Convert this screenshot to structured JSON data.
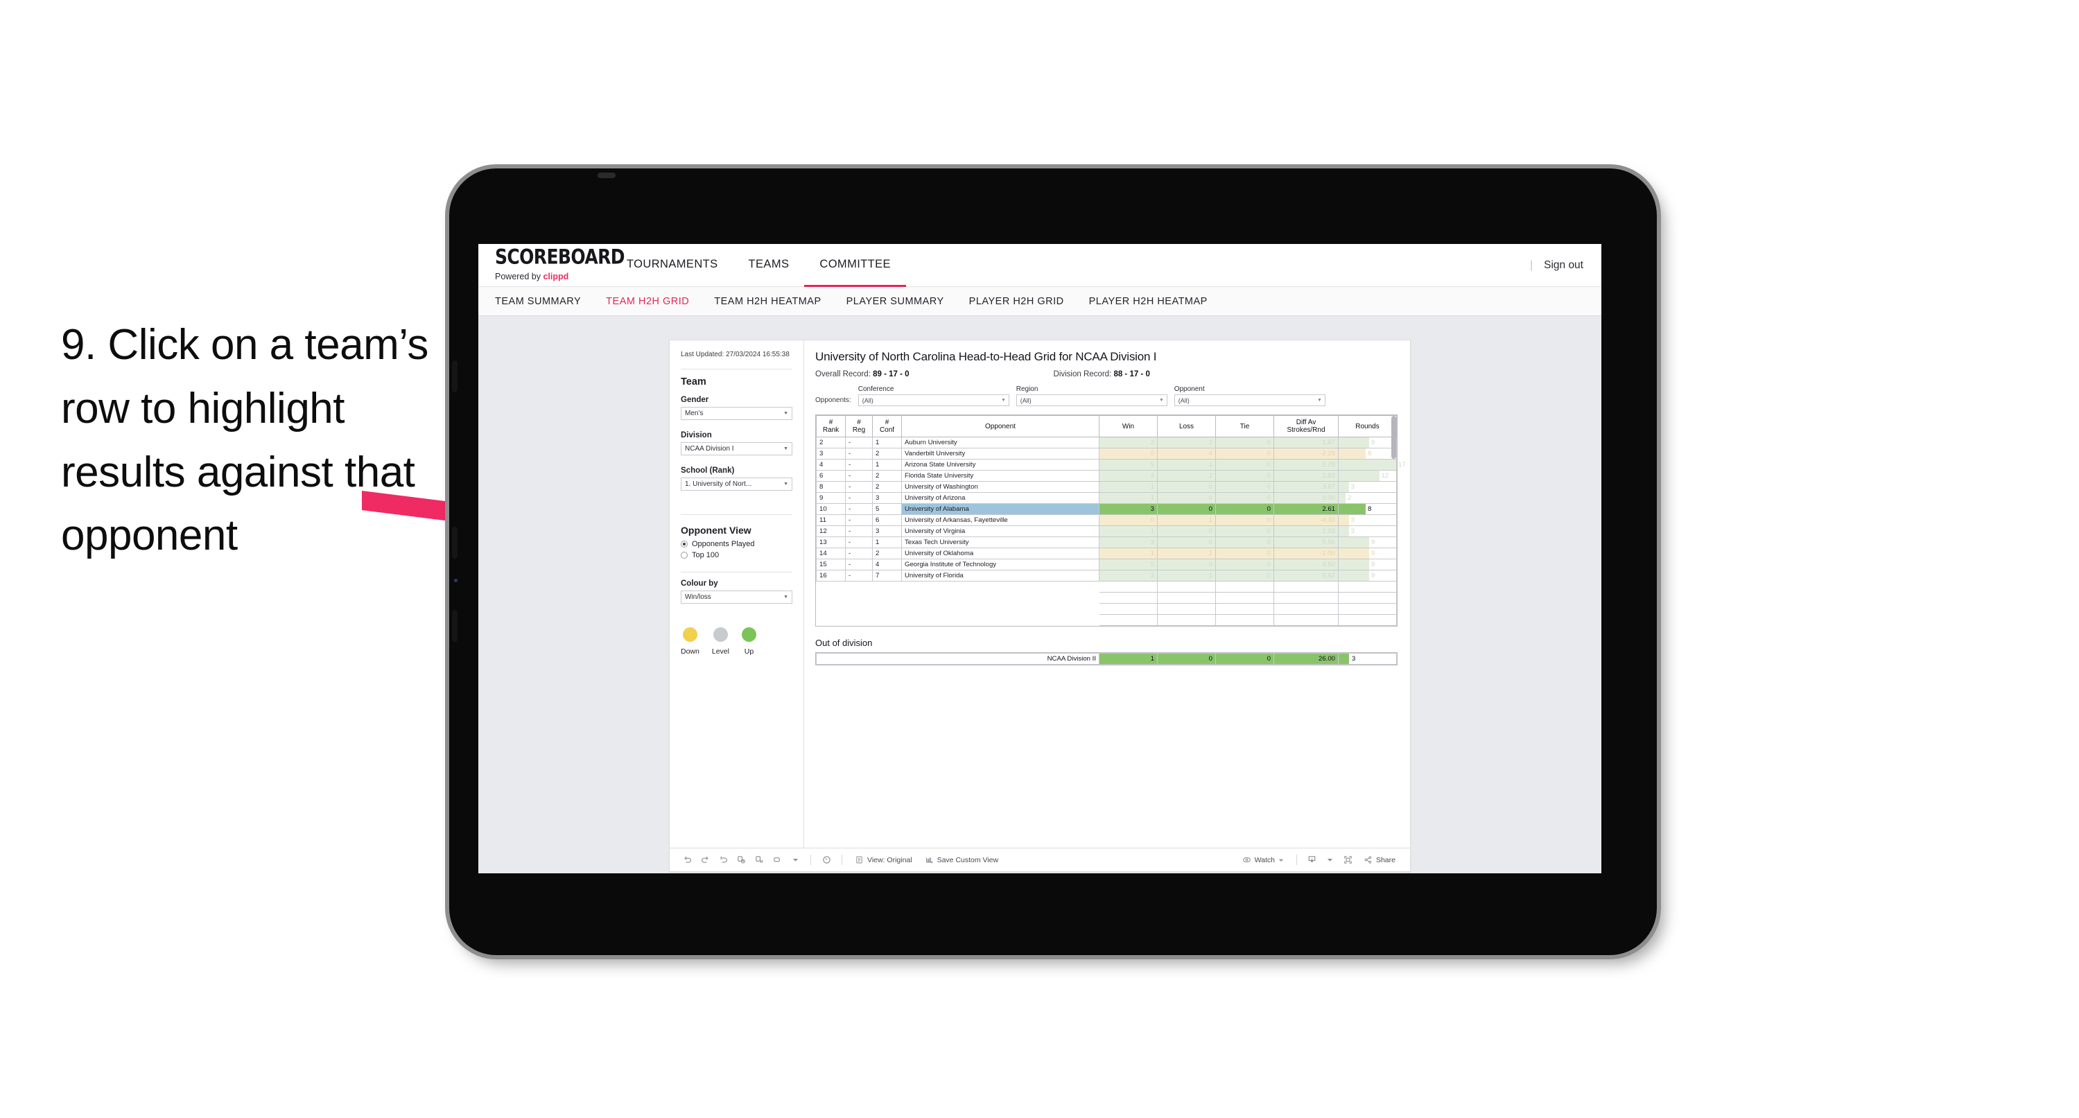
{
  "instruction": {
    "text": "9. Click on a team’s row to highlight results against that opponent"
  },
  "app": {
    "logo": {
      "main": "SCOREBOARD",
      "powered_prefix": "Powered by ",
      "brand": "clippd"
    },
    "nav": [
      {
        "label": "TOURNAMENTS",
        "active": false
      },
      {
        "label": "TEAMS",
        "active": false
      },
      {
        "label": "COMMITTEE",
        "active": true
      }
    ],
    "signout": "Sign out",
    "divider": "|",
    "subnav": [
      {
        "label": "TEAM SUMMARY",
        "active": false
      },
      {
        "label": "TEAM H2H GRID",
        "active": true
      },
      {
        "label": "TEAM H2H HEATMAP",
        "active": false
      },
      {
        "label": "PLAYER SUMMARY",
        "active": false
      },
      {
        "label": "PLAYER H2H GRID",
        "active": false
      },
      {
        "label": "PLAYER H2H HEATMAP",
        "active": false
      }
    ],
    "accent": "#e3265c"
  },
  "sidebar": {
    "last_updated": "Last Updated: 27/03/2024 16:55:38",
    "team_heading": "Team",
    "gender": {
      "label": "Gender",
      "value": "Men’s"
    },
    "division": {
      "label": "Division",
      "value": "NCAA Division I"
    },
    "school": {
      "label": "School (Rank)",
      "value": "1. University of Nort..."
    },
    "opponent_view": {
      "heading": "Opponent View",
      "options": [
        {
          "label": "Opponents Played",
          "selected": true
        },
        {
          "label": "Top 100",
          "selected": false
        }
      ]
    },
    "colour_by": {
      "label": "Colour by",
      "value": "Win/loss"
    },
    "legend": [
      {
        "label": "Down",
        "color": "#f0d04d"
      },
      {
        "label": "Level",
        "color": "#c7cbd0"
      },
      {
        "label": "Up",
        "color": "#7cc35a"
      }
    ]
  },
  "main": {
    "title": "University of North Carolina Head-to-Head Grid for NCAA Division I",
    "overall_record_label": "Overall Record: ",
    "overall_record_value": "89 - 17 - 0",
    "division_record_label": "Division Record: ",
    "division_record_value": "88 - 17 - 0",
    "opponents_label": "Opponents:",
    "filters": [
      {
        "label": "Conference",
        "value": "(All)"
      },
      {
        "label": "Region",
        "value": "(All)"
      },
      {
        "label": "Opponent",
        "value": "(All)"
      }
    ],
    "table": {
      "headers": [
        "# Rank",
        "# Reg",
        "# Conf",
        "Opponent",
        "Win",
        "Loss",
        "Tie",
        "Diff Av Strokes/Rnd",
        "Rounds"
      ],
      "header_lines": [
        [
          "#",
          "Rank"
        ],
        [
          "#",
          "Reg"
        ],
        [
          "#",
          "Conf"
        ],
        [
          "Opponent"
        ],
        [
          "Win"
        ],
        [
          "Loss"
        ],
        [
          "Tie"
        ],
        [
          "Diff Av",
          "Strokes/Rnd"
        ],
        [
          "Rounds"
        ]
      ],
      "rows": [
        {
          "rank": "2",
          "reg": "-",
          "conf": "1",
          "opponent": "Auburn University",
          "win": "2",
          "loss": "1",
          "tie": "0",
          "diff": "1.67",
          "rounds": "9",
          "tone": "up",
          "selected": false
        },
        {
          "rank": "3",
          "reg": "-",
          "conf": "2",
          "opponent": "Vanderbilt University",
          "win": "0",
          "loss": "4",
          "tie": "0",
          "diff": "-2.29",
          "rounds": "8",
          "tone": "down",
          "selected": false
        },
        {
          "rank": "4",
          "reg": "-",
          "conf": "1",
          "opponent": "Arizona State University",
          "win": "5",
          "loss": "1",
          "tie": "0",
          "diff": "2.28",
          "rounds": "17",
          "tone": "up",
          "selected": false
        },
        {
          "rank": "6",
          "reg": "-",
          "conf": "2",
          "opponent": "Florida State University",
          "win": "4",
          "loss": "2",
          "tie": "0",
          "diff": "1.83",
          "rounds": "12",
          "tone": "up",
          "selected": false
        },
        {
          "rank": "8",
          "reg": "-",
          "conf": "2",
          "opponent": "University of Washington",
          "win": "1",
          "loss": "0",
          "tie": "0",
          "diff": "3.67",
          "rounds": "3",
          "tone": "up",
          "selected": false
        },
        {
          "rank": "9",
          "reg": "-",
          "conf": "3",
          "opponent": "University of Arizona",
          "win": "1",
          "loss": "0",
          "tie": "0",
          "diff": "9.00",
          "rounds": "2",
          "tone": "up",
          "selected": false
        },
        {
          "rank": "10",
          "reg": "-",
          "conf": "5",
          "opponent": "University of Alabama",
          "win": "3",
          "loss": "0",
          "tie": "0",
          "diff": "2.61",
          "rounds": "8",
          "tone": "up",
          "selected": true
        },
        {
          "rank": "11",
          "reg": "-",
          "conf": "6",
          "opponent": "University of Arkansas, Fayetteville",
          "win": "0",
          "loss": "1",
          "tie": "0",
          "diff": "-4.33",
          "rounds": "3",
          "tone": "down",
          "selected": false
        },
        {
          "rank": "12",
          "reg": "-",
          "conf": "3",
          "opponent": "University of Virginia",
          "win": "1",
          "loss": "0",
          "tie": "0",
          "diff": "2.33",
          "rounds": "3",
          "tone": "up",
          "selected": false
        },
        {
          "rank": "13",
          "reg": "-",
          "conf": "1",
          "opponent": "Texas Tech University",
          "win": "3",
          "loss": "0",
          "tie": "0",
          "diff": "5.56",
          "rounds": "9",
          "tone": "up",
          "selected": false
        },
        {
          "rank": "14",
          "reg": "-",
          "conf": "2",
          "opponent": "University of Oklahoma",
          "win": "1",
          "loss": "2",
          "tie": "0",
          "diff": "-1.00",
          "rounds": "9",
          "tone": "down",
          "selected": false
        },
        {
          "rank": "15",
          "reg": "-",
          "conf": "4",
          "opponent": "Georgia Institute of Technology",
          "win": "5",
          "loss": "0",
          "tie": "0",
          "diff": "4.50",
          "rounds": "9",
          "tone": "up",
          "selected": false
        },
        {
          "rank": "16",
          "reg": "-",
          "conf": "7",
          "opponent": "University of Florida",
          "win": "3",
          "loss": "1",
          "tie": "0",
          "diff": "6.62",
          "rounds": "9",
          "tone": "up",
          "selected": false
        }
      ]
    },
    "out_of_division": {
      "heading": "Out of division",
      "rows": [
        {
          "opponent": "NCAA Division II",
          "win": "1",
          "loss": "0",
          "tie": "0",
          "diff": "26.00",
          "rounds": "3",
          "tone": "up"
        }
      ]
    }
  },
  "toolbar": {
    "icons": [
      "undo-icon",
      "redo-icon",
      "revert-icon",
      "refresh-icon",
      "pause-icon",
      "zoom-icon",
      "caret-down-icon",
      "comment-icon"
    ],
    "view_original": "View: Original",
    "save_custom_view": "Save Custom View",
    "watch": "Watch",
    "share": "Share"
  },
  "chart_data": {
    "type": "table",
    "title": "University of North Carolina Head-to-Head Grid for NCAA Division I",
    "categories": [
      "Auburn University",
      "Vanderbilt University",
      "Arizona State University",
      "Florida State University",
      "University of Washington",
      "University of Arizona",
      "University of Alabama",
      "University of Arkansas, Fayetteville",
      "University of Virginia",
      "Texas Tech University",
      "University of Oklahoma",
      "Georgia Institute of Technology",
      "University of Florida",
      "NCAA Division II"
    ],
    "series": [
      {
        "name": "Win",
        "values": [
          2,
          0,
          5,
          4,
          1,
          1,
          3,
          0,
          1,
          3,
          1,
          5,
          3,
          1
        ]
      },
      {
        "name": "Loss",
        "values": [
          1,
          4,
          1,
          2,
          0,
          0,
          0,
          1,
          0,
          0,
          2,
          0,
          1,
          0
        ]
      },
      {
        "name": "Tie",
        "values": [
          0,
          0,
          0,
          0,
          0,
          0,
          0,
          0,
          0,
          0,
          0,
          0,
          0,
          0
        ]
      },
      {
        "name": "Diff Av Strokes/Rnd",
        "values": [
          1.67,
          -2.29,
          2.28,
          1.83,
          3.67,
          9.0,
          2.61,
          -4.33,
          2.33,
          5.56,
          -1.0,
          4.5,
          6.62,
          26.0
        ]
      },
      {
        "name": "Rounds",
        "values": [
          9,
          8,
          17,
          12,
          3,
          2,
          8,
          3,
          3,
          9,
          9,
          9,
          9,
          3
        ]
      }
    ],
    "xlabel": "Opponent",
    "ylabel": "",
    "legend_position": "sidebar",
    "grid": true
  }
}
